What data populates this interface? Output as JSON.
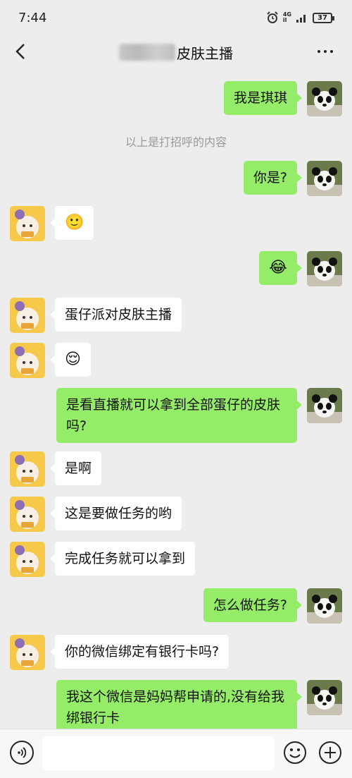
{
  "status": {
    "time": "7:44",
    "network_top": "4G",
    "network_bottom": "il",
    "battery": "37"
  },
  "header": {
    "title_suffix": "皮肤主播"
  },
  "system_note": "以上是打招呼的内容",
  "messages": [
    {
      "side": "me",
      "text": "我是琪琪"
    },
    {
      "side": "me",
      "text": "你是?"
    },
    {
      "side": "them",
      "text": "🙂"
    },
    {
      "side": "me",
      "text": "😂"
    },
    {
      "side": "them",
      "text": "蛋仔派对皮肤主播"
    },
    {
      "side": "them",
      "text": "😌"
    },
    {
      "side": "me",
      "text": "是看直播就可以拿到全部蛋仔的皮肤吗?"
    },
    {
      "side": "them",
      "text": "是啊"
    },
    {
      "side": "them",
      "text": "这是要做任务的哟"
    },
    {
      "side": "them",
      "text": "完成任务就可以拿到"
    },
    {
      "side": "me",
      "text": "怎么做任务?"
    },
    {
      "side": "them",
      "text": "你的微信绑定有银行卡吗?"
    },
    {
      "side": "me",
      "text": "我这个微信是妈妈帮申请的,没有给我绑银行卡"
    }
  ],
  "input": {
    "placeholder": ""
  },
  "icons": {
    "back": "chevron-left-icon",
    "more": "more-dots-icon",
    "voice": "voice-icon",
    "emoji": "emoji-icon",
    "plus": "plus-icon"
  },
  "colors": {
    "my_bubble": "#95ec69",
    "their_bubble": "#ffffff",
    "background": "#ededed"
  }
}
